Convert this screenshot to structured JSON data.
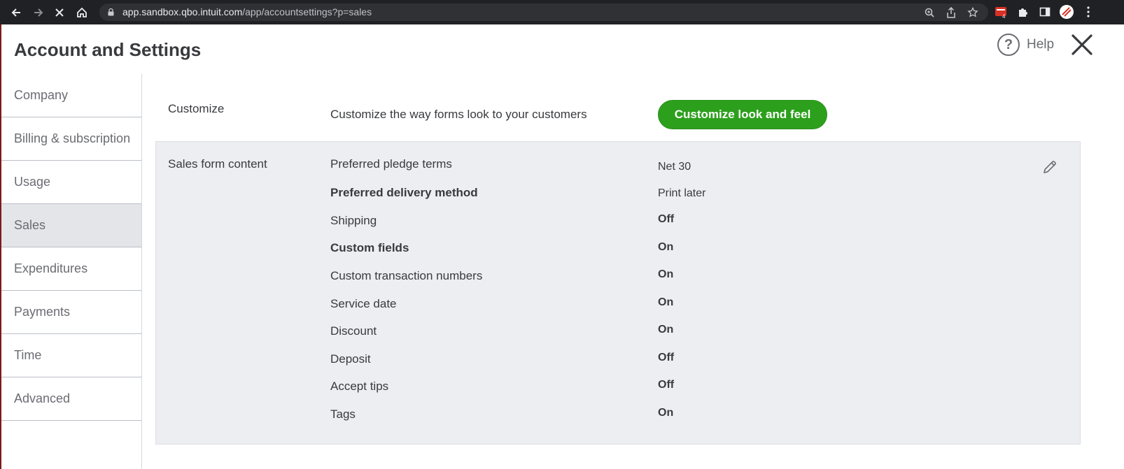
{
  "browser": {
    "url_host": "app.sandbox.qbo.intuit.com",
    "url_path": "/app/accountsettings?p=sales",
    "extension_badge": "4"
  },
  "header": {
    "title": "Account and Settings",
    "help_label": "Help"
  },
  "sidebar": {
    "items": [
      {
        "label": "Company"
      },
      {
        "label": "Billing & subscription"
      },
      {
        "label": "Usage"
      },
      {
        "label": "Sales"
      },
      {
        "label": "Expenditures"
      },
      {
        "label": "Payments"
      },
      {
        "label": "Time"
      },
      {
        "label": "Advanced"
      }
    ],
    "active": "Sales"
  },
  "customize": {
    "section_label": "Customize",
    "description": "Customize the way forms look to your customers",
    "button_label": "Customize look and feel"
  },
  "sales_form_content": {
    "section_label": "Sales form content",
    "rows": [
      {
        "label": "Preferred pledge terms",
        "value": "Net 30"
      },
      {
        "label": "Preferred delivery method",
        "value": "Print later"
      },
      {
        "label": "Shipping",
        "value": "Off"
      },
      {
        "label": "Custom fields",
        "value": "On"
      },
      {
        "label": "Custom transaction numbers",
        "value": "On"
      },
      {
        "label": "Service date",
        "value": "On"
      },
      {
        "label": "Discount",
        "value": "On"
      },
      {
        "label": "Deposit",
        "value": "Off"
      },
      {
        "label": "Accept tips",
        "value": "Off"
      },
      {
        "label": "Tags",
        "value": "On"
      }
    ]
  },
  "colors": {
    "accent_green": "#2ca01c",
    "panel_bg": "#eceef1",
    "active_nav_bg": "#e3e5e8"
  }
}
